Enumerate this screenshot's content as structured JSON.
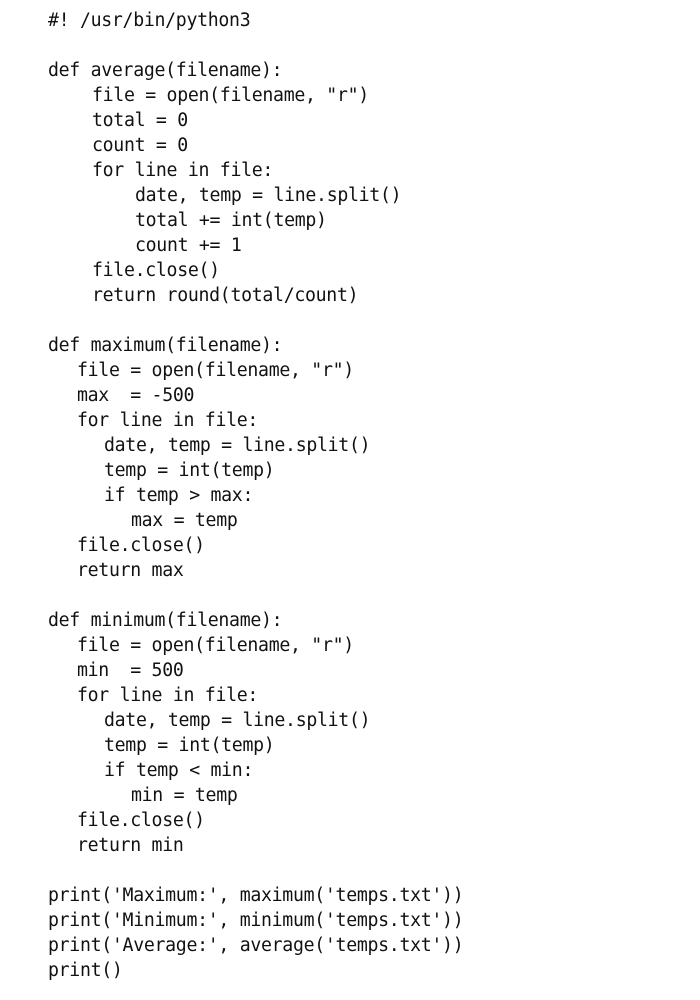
{
  "document": {
    "language": "python",
    "lines": [
      {
        "indent": "i0",
        "text": "#! /usr/bin/python3"
      },
      {
        "indent": "i0",
        "text": ""
      },
      {
        "indent": "i0",
        "text": "def average(filename):"
      },
      {
        "indent": "a1",
        "text": "file = open(filename, \"r\")"
      },
      {
        "indent": "a1",
        "text": "total = 0"
      },
      {
        "indent": "a1",
        "text": "count = 0"
      },
      {
        "indent": "a1",
        "text": "for line in file:"
      },
      {
        "indent": "a2",
        "text": "date, temp = line.split()"
      },
      {
        "indent": "a2",
        "text": "total += int(temp)"
      },
      {
        "indent": "a2",
        "text": "count += 1"
      },
      {
        "indent": "a1",
        "text": "file.close()"
      },
      {
        "indent": "a1",
        "text": "return round(total/count)"
      },
      {
        "indent": "i0",
        "text": ""
      },
      {
        "indent": "i0",
        "text": "def maximum(filename):"
      },
      {
        "indent": "b1",
        "text": "file = open(filename, \"r\")"
      },
      {
        "indent": "b1",
        "text": "max  = -500"
      },
      {
        "indent": "b1",
        "text": "for line in file:"
      },
      {
        "indent": "b2",
        "text": "date, temp = line.split()"
      },
      {
        "indent": "b2",
        "text": "temp = int(temp)"
      },
      {
        "indent": "b2",
        "text": "if temp > max:"
      },
      {
        "indent": "b3",
        "text": "max = temp"
      },
      {
        "indent": "b1",
        "text": "file.close()"
      },
      {
        "indent": "b1",
        "text": "return max"
      },
      {
        "indent": "i0",
        "text": ""
      },
      {
        "indent": "i0",
        "text": "def minimum(filename):"
      },
      {
        "indent": "b1",
        "text": "file = open(filename, \"r\")"
      },
      {
        "indent": "b1",
        "text": "min  = 500"
      },
      {
        "indent": "b1",
        "text": "for line in file:"
      },
      {
        "indent": "b2",
        "text": "date, temp = line.split()"
      },
      {
        "indent": "b2",
        "text": "temp = int(temp)"
      },
      {
        "indent": "b2",
        "text": "if temp < min:"
      },
      {
        "indent": "b3",
        "text": "min = temp"
      },
      {
        "indent": "b1",
        "text": "file.close()"
      },
      {
        "indent": "b1",
        "text": "return min"
      },
      {
        "indent": "i0",
        "text": ""
      },
      {
        "indent": "i0",
        "text": "print('Maximum:', maximum('temps.txt'))"
      },
      {
        "indent": "i0",
        "text": "print('Minimum:', minimum('temps.txt'))"
      },
      {
        "indent": "i0",
        "text": "print('Average:', average('temps.txt'))"
      },
      {
        "indent": "i0",
        "text": "print()"
      }
    ]
  }
}
